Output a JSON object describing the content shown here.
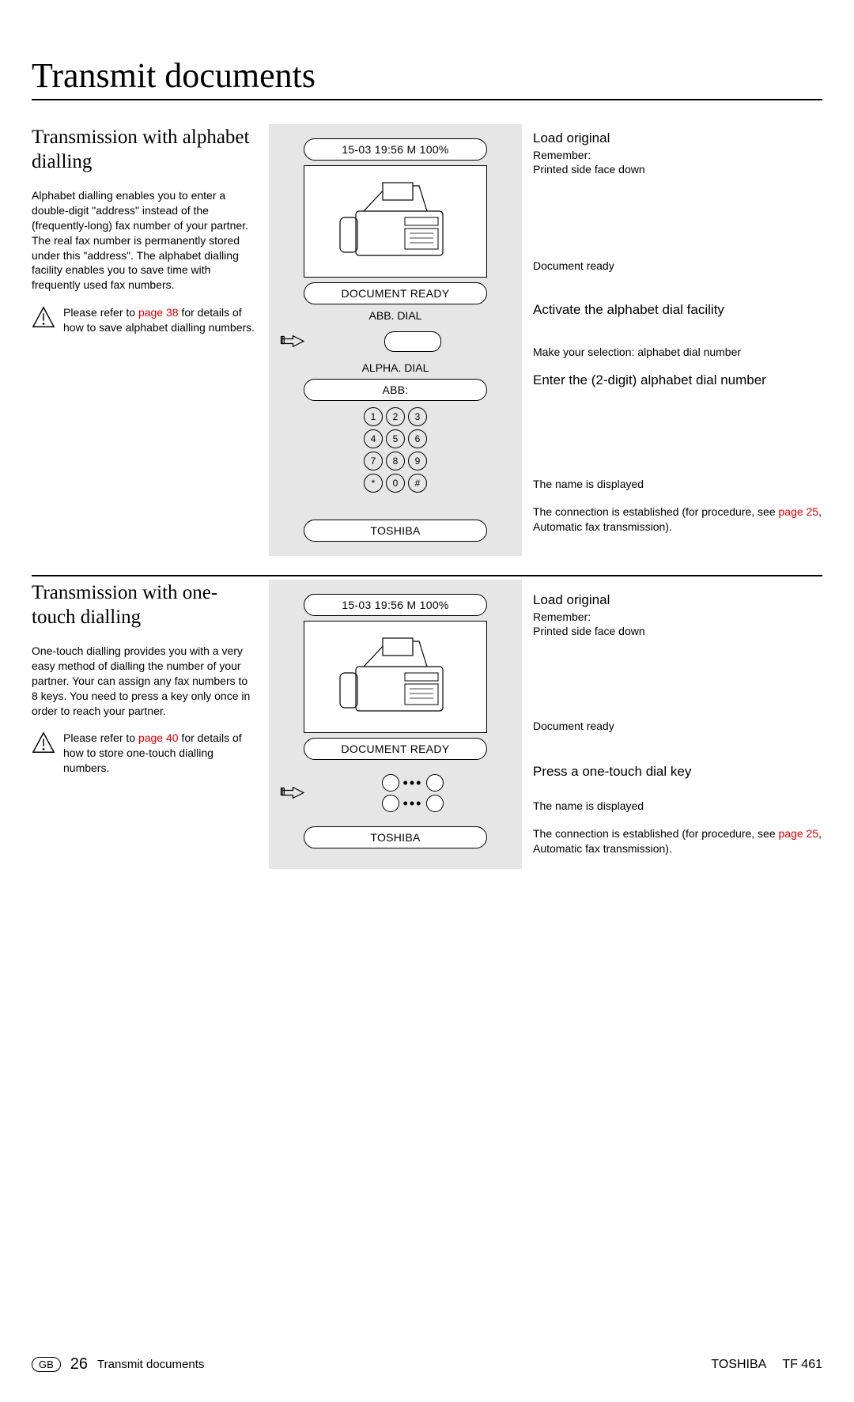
{
  "title": "Transmit documents",
  "section1": {
    "heading": "Transmission with alphabet dialling",
    "body": "Alphabet dialling enables you to enter a double-digit \"address\" instead of the (frequently-long) fax number of your partner. The real fax number is permanently stored under this \"address\". The alphabet dialling facility enables you to save time with frequently used fax numbers.",
    "note_pre": "Please refer to ",
    "note_link": "page 38",
    "note_post": " for details of how to save alphabet dialling numbers.",
    "display_time": "15-03 19:56  M 100%",
    "doc_ready": "DOCUMENT READY",
    "abb_dial": "ABB. DIAL",
    "alpha_dial": "ALPHA. DIAL",
    "abb_prompt": "ABB:",
    "name_result": "TOSHIBA",
    "keys": [
      "1",
      "2",
      "3",
      "4",
      "5",
      "6",
      "7",
      "8",
      "9",
      "*",
      "0",
      "#"
    ],
    "r1_title": "Load original",
    "r1_sub1": "Remember:",
    "r1_sub2": "Printed side face down",
    "r_doc_ready": "Document ready",
    "r_activate": "Activate the alphabet dial facility",
    "r_make_sel": "Make your selection: alphabet dial number",
    "r_enter": "Enter the (2-digit) alphabet dial number",
    "r_name_disp": "The name is displayed",
    "r_conn_pre": "The connection is established (for procedure, see ",
    "r_conn_link": "page 25",
    "r_conn_post": ", Automatic fax transmission)."
  },
  "section2": {
    "heading": "Transmission with one-touch dialling",
    "body": "One-touch dialling provides you with a very easy method of dialling the number of your partner. Your can assign any fax numbers to 8 keys. You need to press a key only once in order to reach your partner.",
    "note_pre": "Please refer to ",
    "note_link": "page 40",
    "note_post": " for details of how to store one-touch dialling numbers.",
    "display_time": "15-03 19:56  M 100%",
    "doc_ready": "DOCUMENT READY",
    "name_result": "TOSHIBA",
    "r1_title": "Load original",
    "r1_sub1": "Remember:",
    "r1_sub2": "Printed side face down",
    "r_doc_ready": "Document ready",
    "r_press": "Press a one-touch dial key",
    "r_name_disp": "The name is displayed",
    "r_conn_pre": "The connection is established (for procedure, see ",
    "r_conn_link": "page 25",
    "r_conn_post": ", Automatic fax transmission)."
  },
  "footer": {
    "gb": "GB",
    "page_num": "26",
    "section": "Transmit documents",
    "brand": "TOSHIBA",
    "model": "TF 461"
  }
}
